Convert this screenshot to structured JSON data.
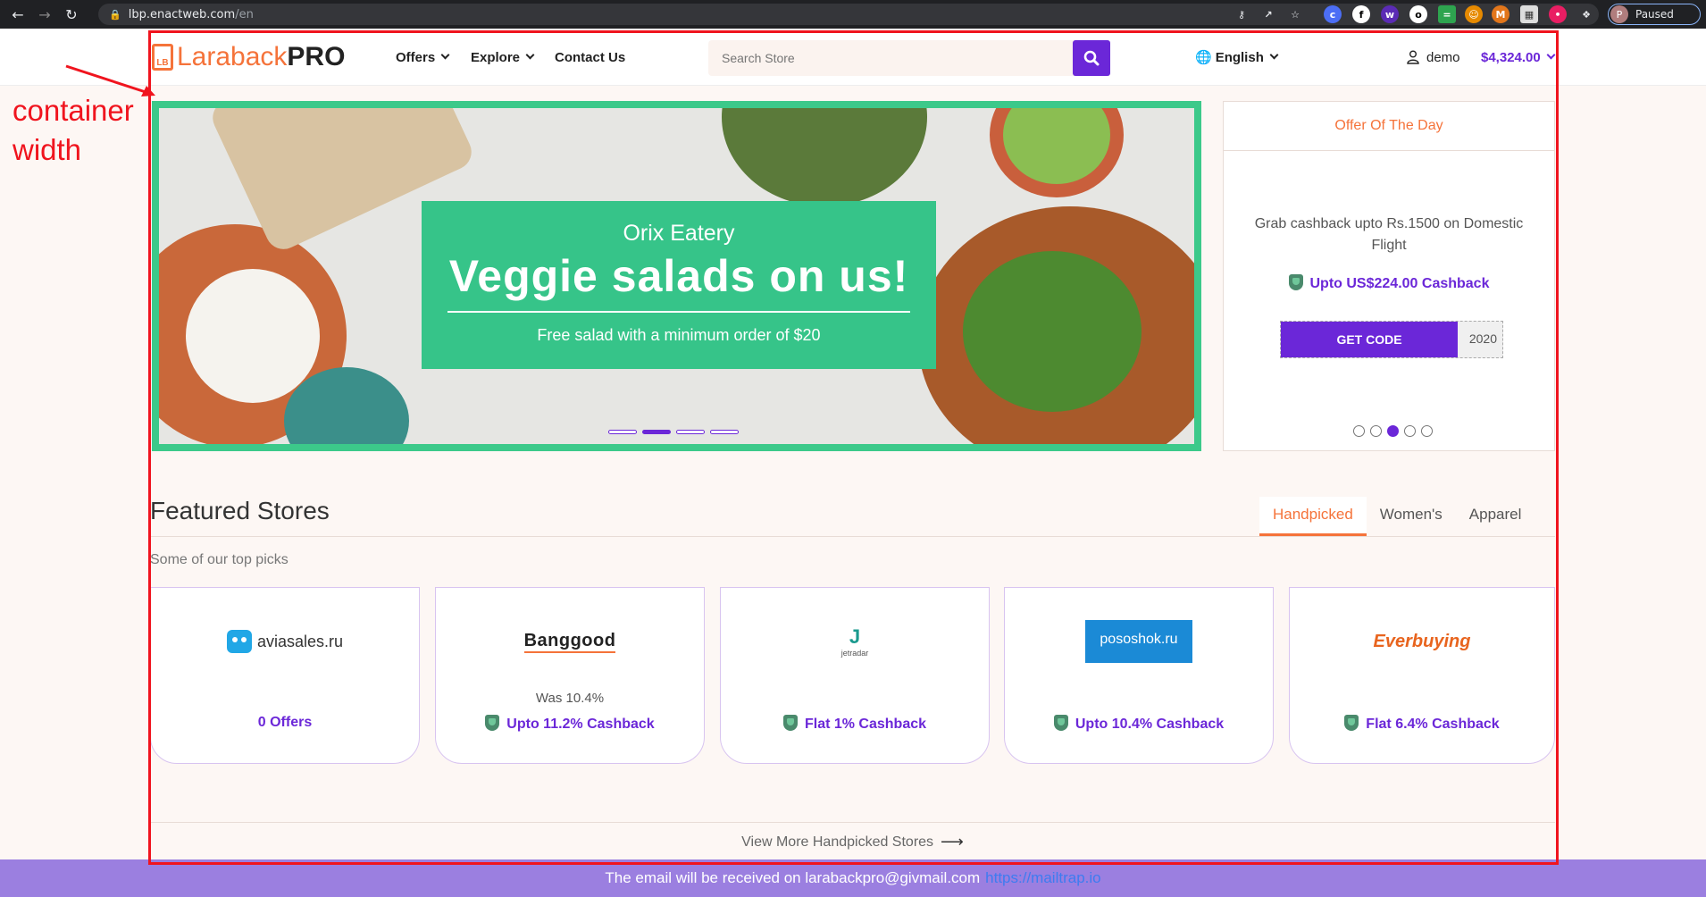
{
  "browser": {
    "url_host": "lbp.enactweb.com",
    "url_path": "/en",
    "profile_initial": "P",
    "profile_status": "Paused"
  },
  "header": {
    "logo_part1": "Laraback",
    "logo_part2": "PRO",
    "logo_badge": "LB",
    "menu": [
      {
        "label": "Offers"
      },
      {
        "label": "Explore"
      },
      {
        "label": "Contact Us"
      }
    ],
    "search_placeholder": "Search Store",
    "language": "English",
    "user": "demo",
    "balance": "$4,324.00"
  },
  "annotation": {
    "label_line1": "container",
    "label_line2": "width"
  },
  "banner": {
    "subtitle": "Orix Eatery",
    "title": "Veggie salads on us!",
    "caption": "Free salad with a minimum order of $20",
    "active_slide": 2,
    "slide_count": 4
  },
  "offer_of_day": {
    "heading": "Offer Of The Day",
    "description": "Grab cashback upto Rs.1500 on Domestic Flight",
    "cashback": "Upto US$224.00 Cashback",
    "button": "GET CODE",
    "code_peek": "2020",
    "active_dot": 3,
    "dot_count": 5
  },
  "featured": {
    "title": "Featured Stores",
    "subtitle": "Some of our top picks",
    "tabs": [
      "Handpicked",
      "Women's",
      "Apparel"
    ],
    "active_tab": "Handpicked",
    "stores": [
      {
        "name": "aviasales.ru",
        "was": "",
        "cashback": "0 Offers",
        "show_shield": false
      },
      {
        "name": "Banggood",
        "was": "Was 10.4%",
        "cashback": "Upto 11.2% Cashback",
        "show_shield": true
      },
      {
        "name": "jetradar",
        "was": "",
        "cashback": "Flat 1% Cashback",
        "show_shield": true
      },
      {
        "name": "pososhok.ru",
        "was": "",
        "cashback": "Upto 10.4% Cashback",
        "show_shield": true
      },
      {
        "name": "Everbuying",
        "was": "",
        "cashback": "Flat 6.4% Cashback",
        "show_shield": true
      }
    ],
    "view_more": "View More Handpicked Stores"
  },
  "footer": {
    "text": "The email will be received on larabackpro@givmail.com",
    "link": "https://mailtrap.io"
  },
  "colors": {
    "accent": "#6b27d8",
    "orange": "#f5733a",
    "green": "#36c489",
    "annotation_red": "#f0141e",
    "footer": "#9b7fe0"
  }
}
